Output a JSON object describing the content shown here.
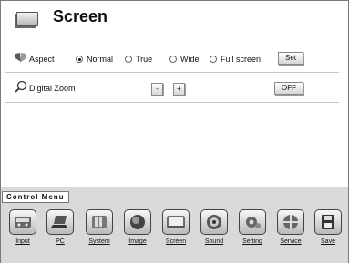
{
  "header": {
    "title": "Screen"
  },
  "aspect": {
    "label": "Aspect",
    "options": [
      {
        "label": "Normal",
        "selected": true
      },
      {
        "label": "True",
        "selected": false
      },
      {
        "label": "Wide",
        "selected": false
      },
      {
        "label": "Full screen",
        "selected": false
      }
    ],
    "set_label": "Set"
  },
  "digital_zoom": {
    "label": "Digital Zoom",
    "minus_label": "-",
    "plus_label": "+",
    "status_label": "OFF"
  },
  "control_menu": {
    "title": "Control Menu",
    "items": [
      {
        "label": "Input",
        "icon": "input-icon"
      },
      {
        "label": "PC",
        "icon": "pc-icon"
      },
      {
        "label": "System",
        "icon": "system-icon"
      },
      {
        "label": "Image",
        "icon": "image-icon"
      },
      {
        "label": "Screen",
        "icon": "screen-icon"
      },
      {
        "label": "Sound",
        "icon": "sound-icon"
      },
      {
        "label": "Setting",
        "icon": "setting-icon"
      },
      {
        "label": "Service",
        "icon": "service-icon"
      },
      {
        "label": "Save",
        "icon": "save-icon"
      }
    ]
  }
}
